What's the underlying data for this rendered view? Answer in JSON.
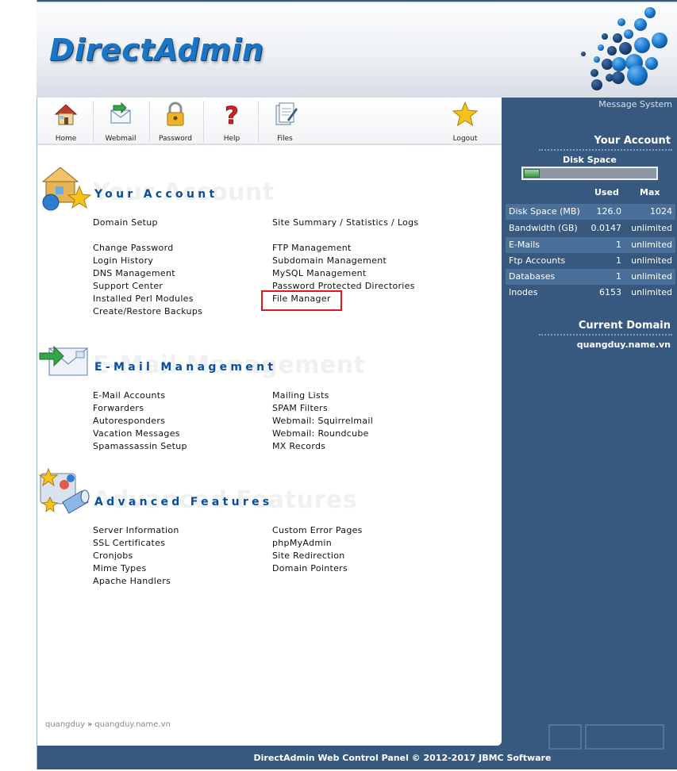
{
  "header": {
    "logo_text": "DirectAdmin"
  },
  "toolbar": {
    "items": [
      {
        "label": "Home",
        "icon": "home-icon"
      },
      {
        "label": "Webmail",
        "icon": "webmail-icon"
      },
      {
        "label": "Password",
        "icon": "lock-icon"
      },
      {
        "label": "Help",
        "icon": "help-icon"
      },
      {
        "label": "Files",
        "icon": "files-icon"
      },
      {
        "label": "Logout",
        "icon": "star-icon"
      }
    ]
  },
  "sections": {
    "account": {
      "title": "Your Account",
      "watermark": "Your Account",
      "icon": "account-house-icon",
      "links_left": [
        "Domain Setup",
        "Change Password",
        "Login History",
        "DNS Management",
        "Support Center",
        "Installed Perl Modules",
        "Create/Restore Backups"
      ],
      "links_right": [
        "Site Summary / Statistics / Logs",
        "FTP Management",
        "Subdomain Management",
        "MySQL Management",
        "Password Protected Directories",
        "File Manager"
      ]
    },
    "email": {
      "title": "E-Mail Management",
      "watermark": "E-Mail Management",
      "icon": "email-icon",
      "links_left": [
        "E-Mail Accounts",
        "Forwarders",
        "Autoresponders",
        "Vacation Messages",
        "Spamassassin Setup"
      ],
      "links_right": [
        "Mailing Lists",
        "SPAM Filters",
        "Webmail: Squirrelmail",
        "Webmail: Roundcube",
        "MX Records"
      ]
    },
    "advanced": {
      "title": "Advanced Features",
      "watermark": "Advanced Features",
      "icon": "advanced-features-icon",
      "links_left": [
        "Server Information",
        "SSL Certificates",
        "Cronjobs",
        "Mime Types",
        "Apache Handlers"
      ],
      "links_right": [
        "Custom Error Pages",
        "phpMyAdmin",
        "Site Redirection",
        "Domain Pointers"
      ]
    }
  },
  "breadcrumb": {
    "user": "quangduy",
    "separator": "»",
    "domain": "quangduy.name.vn"
  },
  "sidebar": {
    "message_system": "Message System",
    "account_title": "Your Account",
    "disk_label": "Disk Space",
    "disk_usage_fraction": 0.123,
    "col_used": "Used",
    "col_max": "Max",
    "stats": [
      {
        "name": "Disk Space (MB)",
        "used": "126.0",
        "max": "1024"
      },
      {
        "name": "Bandwidth (GB)",
        "used": "0.0147",
        "max": "unlimited"
      },
      {
        "name": "E-Mails",
        "used": "1",
        "max": "unlimited"
      },
      {
        "name": "Ftp Accounts",
        "used": "1",
        "max": "unlimited"
      },
      {
        "name": "Databases",
        "used": "1",
        "max": "unlimited"
      },
      {
        "name": "Inodes",
        "used": "6153",
        "max": "unlimited"
      }
    ],
    "domain_title": "Current Domain",
    "domain_value": "quangduy.name.vn"
  },
  "footer": {
    "text": "DirectAdmin Web Control Panel © 2012-2017 JBMC Software"
  },
  "colors": {
    "panel": "#37597f",
    "title": "#0a4f9c",
    "logo": "#1b74c4",
    "highlight": "#e0181c"
  }
}
